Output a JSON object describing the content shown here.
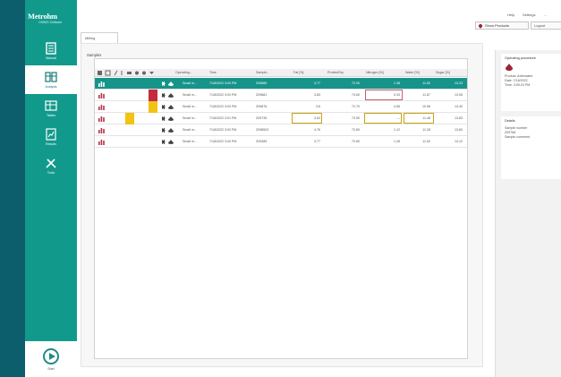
{
  "app": {
    "brand": "Metrohm",
    "brand_sub": "OMNIS Software"
  },
  "sidebar": {
    "items": [
      {
        "label": "Manual",
        "icon": "manual-icon"
      },
      {
        "label": "Analysis",
        "icon": "analysis-icon",
        "active": true
      },
      {
        "label": "Tables",
        "icon": "tables-icon"
      },
      {
        "label": "Results",
        "icon": "results-icon"
      },
      {
        "label": "Tools",
        "icon": "tools-icon"
      }
    ],
    "start_label": "Start"
  },
  "topbar": {
    "help": "Help",
    "settings": "Settings",
    "more": "...",
    "show_products": "Show Products",
    "logout": "Logout"
  },
  "tabs": [
    "Milling"
  ],
  "samples_title": "Samples",
  "table": {
    "columns": [
      "Operating...",
      "Time",
      "Sample...",
      "Fat [%]",
      "Protein/Dry",
      "Nitrogen [%]",
      "Water [%]",
      "Sugar [%]"
    ],
    "rows": [
      {
        "op": "Small m...",
        "time": "7/18/2022 3:00 PM",
        "sample": "Z09889",
        "fat": "3.77",
        "protein": "72.00",
        "nitrogen": "1.38",
        "water": "11.52",
        "sugar": "13.23",
        "selected": true,
        "flag": ""
      },
      {
        "op": "Small m...",
        "time": "7/18/2022 3:00 PM",
        "sample": "Z09881",
        "fat": "3.83",
        "protein": "73.60",
        "nitrogen": "5.33",
        "water": "11.87",
        "sugar": "13.06",
        "selected": false,
        "flag": "red"
      },
      {
        "op": "Small m...",
        "time": "7/18/2022 3:00 PM",
        "sample": "Z09876",
        "fat": "3.6",
        "protein": "72.70",
        "nitrogen": "4.56",
        "water": "10.96",
        "sugar": "14.40",
        "selected": false,
        "flag": "yellow"
      },
      {
        "op": "Small m...",
        "time": "7/18/2022 3:01 PM",
        "sample": "Z09735",
        "fat": "3.63",
        "protein": "73.50",
        "nitrogen": "---",
        "water": "11.48",
        "sugar": "13.83",
        "selected": false,
        "flag": "yellow2"
      },
      {
        "op": "Small m...",
        "time": "7/18/2022 3:00 PM",
        "sample": "Z098523",
        "fat": "4.76",
        "protein": "72.80",
        "nitrogen": "1.12",
        "water": "11.28",
        "sugar": "13.80",
        "selected": false,
        "flag": ""
      },
      {
        "op": "Small m...",
        "time": "7/18/2022 3:00 PM",
        "sample": "Z09389",
        "fat": "3.77",
        "protein": "72.80",
        "nitrogen": "1.28",
        "water": "11.52",
        "sugar": "14.12",
        "selected": false,
        "flag": ""
      }
    ]
  },
  "right_panel": {
    "card1_title": "Operating procedure",
    "card1_lines": [
      "Product: Adrenaline",
      "Date: 7/18/2022",
      "Time: 3:59:23 PM"
    ],
    "card2_title": "Details",
    "card2_lines": [
      "Sample number",
      "Z09766",
      "Sample comment"
    ]
  },
  "colors": {
    "brand": "#119a8c",
    "selected": "#16948a",
    "flag_red": "#c42b3c",
    "flag_yellow": "#f2c214",
    "bg": "#0c5e6c"
  }
}
